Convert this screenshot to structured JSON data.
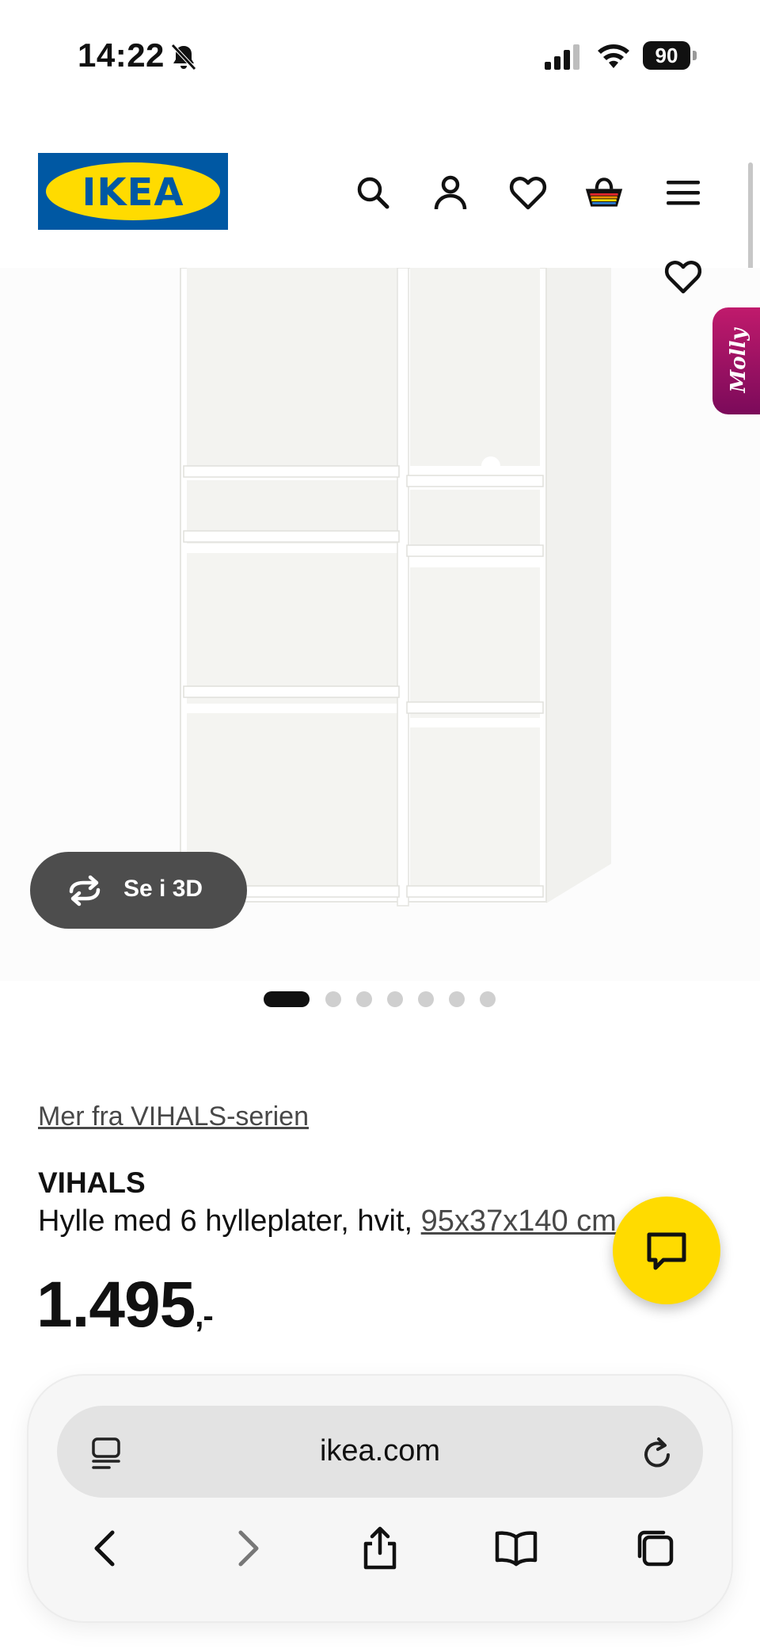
{
  "status_bar": {
    "time": "14:22",
    "battery": "90"
  },
  "header": {
    "logo_text": "IKEA",
    "icons": [
      "search-icon",
      "user-icon",
      "heart-icon",
      "cart-icon",
      "menu-icon"
    ]
  },
  "gallery": {
    "molly_label": "Molly",
    "view_3d_label": "Se i 3D",
    "image_count": 7,
    "active_index": 0
  },
  "product": {
    "series_link": "Mer fra VIHALS-serien",
    "name": "VIHALS",
    "description": "Hylle med 6 hylleplater, hvit, ",
    "dimensions": "95x37x140 cm",
    "price": "1.495",
    "price_suffix": ",-"
  },
  "browser": {
    "address": "ikea.com"
  },
  "colors": {
    "ikea_blue": "#0058a3",
    "ikea_yellow": "#ffdb00",
    "molly_magenta": "#b0156a"
  }
}
